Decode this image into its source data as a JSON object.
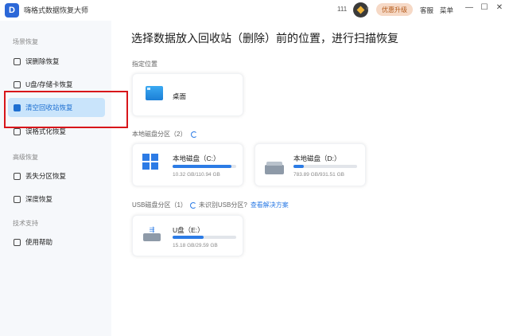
{
  "app": {
    "title": "嗨格式数据恢复大师",
    "logo_letter": "D"
  },
  "header": {
    "user_id": "111",
    "upgrade_label": "优惠升级",
    "service_label": "客服",
    "menu_label": "菜单",
    "minimize": "—",
    "maximize": "☐",
    "close": "✕",
    "vip_chevron": "▾"
  },
  "sidebar": {
    "sections": [
      {
        "title": "场景恢复"
      },
      {
        "title": "高级恢复"
      },
      {
        "title": "技术支持"
      }
    ],
    "items": [
      {
        "label": "误删除恢复"
      },
      {
        "label": "U盘/存储卡恢复"
      },
      {
        "label": "清空回收站恢复"
      },
      {
        "label": "误格式化恢复"
      },
      {
        "label": "丢失分区恢复"
      },
      {
        "label": "深度恢复"
      },
      {
        "label": "使用帮助"
      }
    ]
  },
  "main": {
    "title": "选择数据放入回收站（删除）前的位置，进行扫描恢复",
    "designated": {
      "label": "指定位置",
      "desktop_name": "桌面"
    },
    "local_disks": {
      "label": "本地磁盘分区（2）",
      "disks": [
        {
          "name": "本地磁盘（C:）",
          "size": "10.32 GB/110.94 GB",
          "used_fraction": 0.93
        },
        {
          "name": "本地磁盘（D:）",
          "size": "783.89 GB/931.51 GB",
          "used_fraction": 0.16
        }
      ]
    },
    "usb": {
      "label": "USB磁盘分区（1）",
      "unrecognized": "未识别USB分区?",
      "solution_link": "查看解决方案",
      "disk": {
        "name": "U盘（E:）",
        "size": "15.18 GB/29.59 GB",
        "used_fraction": 0.49
      }
    }
  }
}
